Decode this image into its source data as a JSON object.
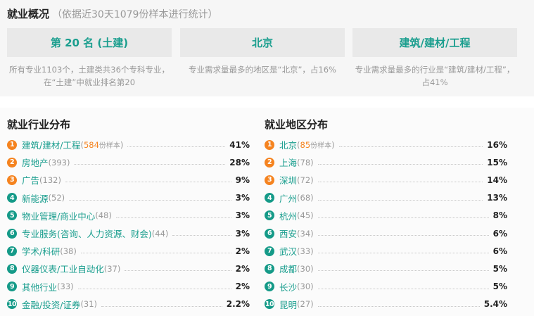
{
  "overview": {
    "title": "就业概况",
    "subtitle": "（依据近30天1079份样本进行统计）",
    "cards": [
      {
        "value": "第 20 名 (土建)",
        "desc": "所有专业1103个，土建类共36个专科专业，在“土建”中就业排名第20"
      },
      {
        "value": "北京",
        "desc": "专业需求量最多的地区是“北京”，占16%"
      },
      {
        "value": "建筑/建材/工程",
        "desc": "专业需求量最多的行业是“建筑/建材/工程”，占41%"
      }
    ]
  },
  "industry": {
    "title": "就业行业分布",
    "unit": "份样本",
    "items": [
      {
        "rank": "1",
        "name": "建筑/建材/工程",
        "count": "584",
        "pct": "41%"
      },
      {
        "rank": "2",
        "name": "房地产",
        "count": "(393)",
        "pct": "28%"
      },
      {
        "rank": "3",
        "name": "广告",
        "count": "(132)",
        "pct": "9%"
      },
      {
        "rank": "4",
        "name": "新能源",
        "count": "(52)",
        "pct": "3%"
      },
      {
        "rank": "5",
        "name": "物业管理/商业中心",
        "count": "(48)",
        "pct": "3%"
      },
      {
        "rank": "6",
        "name": "专业服务(咨询、人力资源、财会)",
        "count": "(44)",
        "pct": "3%"
      },
      {
        "rank": "7",
        "name": "学术/科研",
        "count": "(38)",
        "pct": "2%"
      },
      {
        "rank": "8",
        "name": "仪器仪表/工业自动化",
        "count": "(37)",
        "pct": "2%"
      },
      {
        "rank": "9",
        "name": "其他行业",
        "count": "(33)",
        "pct": "2%"
      },
      {
        "rank": "10",
        "name": "金融/投资/证券",
        "count": "(31)",
        "pct": "2.2%"
      }
    ]
  },
  "region": {
    "title": "就业地区分布",
    "unit": "份样本",
    "items": [
      {
        "rank": "1",
        "name": "北京",
        "count": "85",
        "pct": "16%"
      },
      {
        "rank": "2",
        "name": "上海",
        "count": "(78)",
        "pct": "15%"
      },
      {
        "rank": "3",
        "name": "深圳",
        "count": "(72)",
        "pct": "14%"
      },
      {
        "rank": "4",
        "name": "广州",
        "count": "(68)",
        "pct": "13%"
      },
      {
        "rank": "5",
        "name": "杭州",
        "count": "(45)",
        "pct": "8%"
      },
      {
        "rank": "6",
        "name": "西安",
        "count": "(34)",
        "pct": "6%"
      },
      {
        "rank": "7",
        "name": "武汉",
        "count": "(33)",
        "pct": "6%"
      },
      {
        "rank": "8",
        "name": "成都",
        "count": "(30)",
        "pct": "5%"
      },
      {
        "rank": "9",
        "name": "长沙",
        "count": "(30)",
        "pct": "5%"
      },
      {
        "rank": "10",
        "name": "昆明",
        "count": "(27)",
        "pct": "5.4%"
      }
    ]
  },
  "colors": {
    "accent": "#1a9e8e",
    "rank_top": "#f5831f",
    "rank_rest": "#159a88"
  }
}
